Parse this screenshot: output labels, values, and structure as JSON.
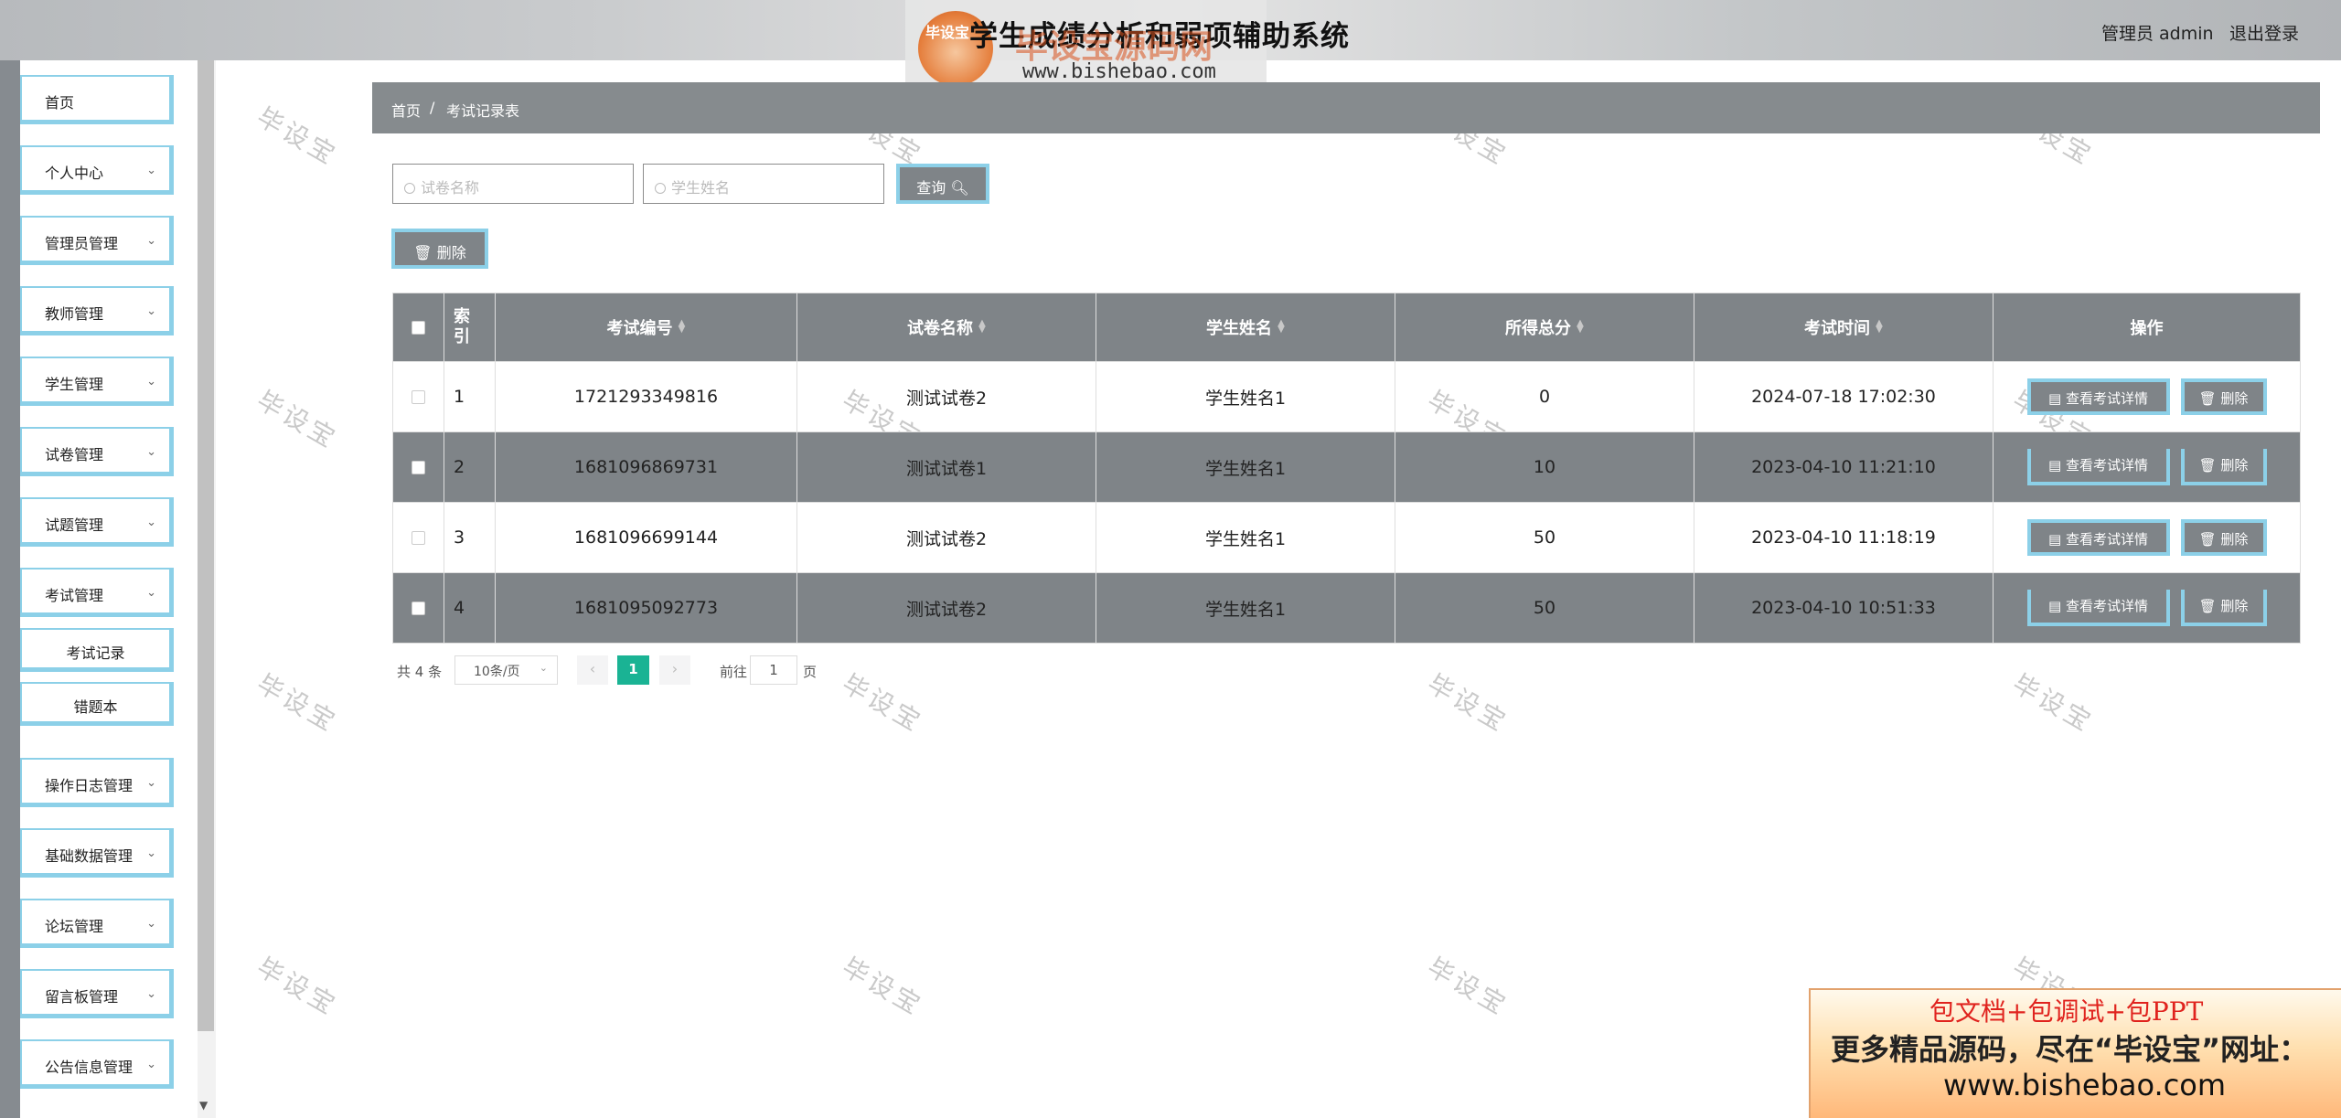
{
  "header": {
    "system_title": "学生成绩分析和弱项辅助系统",
    "user_label": "管理员 admin",
    "logout_label": "退出登录",
    "logo_badge": "毕设宝",
    "logo_text": "毕设宝源码网",
    "logo_url": "www.bishebao.com"
  },
  "sidebar": {
    "items": [
      {
        "label": "首页",
        "has_chevron": false
      },
      {
        "label": "个人中心",
        "has_chevron": true
      },
      {
        "label": "管理员管理",
        "has_chevron": true
      },
      {
        "label": "教师管理",
        "has_chevron": true
      },
      {
        "label": "学生管理",
        "has_chevron": true
      },
      {
        "label": "试卷管理",
        "has_chevron": true
      },
      {
        "label": "试题管理",
        "has_chevron": true
      },
      {
        "label": "考试管理",
        "has_chevron": true
      },
      {
        "label": "操作日志管理",
        "has_chevron": true
      },
      {
        "label": "基础数据管理",
        "has_chevron": true
      },
      {
        "label": "论坛管理",
        "has_chevron": true
      },
      {
        "label": "留言板管理",
        "has_chevron": true
      },
      {
        "label": "公告信息管理",
        "has_chevron": true
      }
    ],
    "sub_items": [
      "考试记录",
      "错题本"
    ]
  },
  "breadcrumb": {
    "home": "首页",
    "separator": "/",
    "current": "考试记录表"
  },
  "search": {
    "paper_placeholder": "试卷名称",
    "student_placeholder": "学生姓名",
    "query_label": "查询"
  },
  "actions": {
    "delete_label": "删除"
  },
  "table": {
    "headers": {
      "index": "索引",
      "exam_no": "考试编号",
      "paper_name": "试卷名称",
      "student_name": "学生姓名",
      "score": "所得总分",
      "exam_time": "考试时间",
      "ops": "操作"
    },
    "view_label": "查看考试详情",
    "delete_label": "删除",
    "rows": [
      {
        "index": "1",
        "exam_no": "1721293349816",
        "paper_name": "测试试卷2",
        "student_name": "学生姓名1",
        "score": "0",
        "exam_time": "2024-07-18 17:02:30"
      },
      {
        "index": "2",
        "exam_no": "1681096869731",
        "paper_name": "测试试卷1",
        "student_name": "学生姓名1",
        "score": "10",
        "exam_time": "2023-04-10 11:21:10"
      },
      {
        "index": "3",
        "exam_no": "1681096699144",
        "paper_name": "测试试卷2",
        "student_name": "学生姓名1",
        "score": "50",
        "exam_time": "2023-04-10 11:18:19"
      },
      {
        "index": "4",
        "exam_no": "1681095092773",
        "paper_name": "测试试卷2",
        "student_name": "学生姓名1",
        "score": "50",
        "exam_time": "2023-04-10 10:51:33"
      }
    ]
  },
  "pagination": {
    "total": "共 4 条",
    "page_size": "10条/页",
    "current_page": "1",
    "goto_label": "前往",
    "goto_value": "1",
    "page_suffix": "页"
  },
  "watermark": "毕设宝",
  "ad": {
    "line1": "包文档+包调试+包PPT",
    "line2": "更多精品源码，尽在“毕设宝”网址：",
    "line3": "www.bishebao.com"
  },
  "colors": {
    "accent_border": "#8cd0e8",
    "header_gray": "#7f8488",
    "page_active": "#1ab394",
    "ad_red": "#e0231e"
  }
}
